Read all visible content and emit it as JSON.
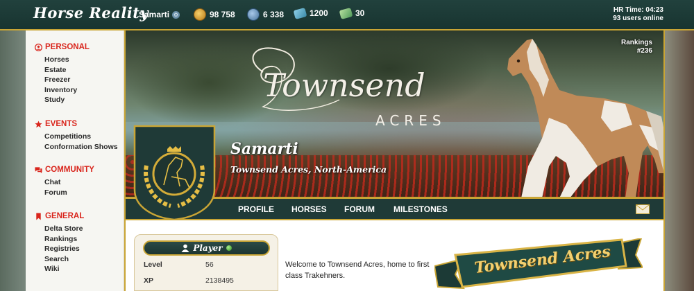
{
  "topbar": {
    "logo": "Horse Reality",
    "username": "Samarti",
    "currencies": [
      {
        "name": "coins",
        "icon": "coin-icon",
        "value": "98 758"
      },
      {
        "name": "passes",
        "icon": "pass-icon",
        "value": "6 338"
      },
      {
        "name": "tickets-blue",
        "icon": "ticket-icon",
        "value": "1200"
      },
      {
        "name": "tickets-green",
        "icon": "ticket-icon",
        "value": "30"
      }
    ],
    "time": "HR Time: 04:23",
    "online": "93 users online"
  },
  "sidebar": {
    "sections": [
      {
        "title": "PERSONAL",
        "icon": "user-icon",
        "items": [
          "Horses",
          "Estate",
          "Freezer",
          "Inventory",
          "Study"
        ]
      },
      {
        "title": "EVENTS",
        "icon": "star-icon",
        "items": [
          "Competitions",
          "Conformation Shows"
        ]
      },
      {
        "title": "COMMUNITY",
        "icon": "chat-icon",
        "items": [
          "Chat",
          "Forum"
        ]
      },
      {
        "title": "GENERAL",
        "icon": "bookmark-icon",
        "items": [
          "Delta Store",
          "Rankings",
          "Registries",
          "Search",
          "Wiki"
        ]
      }
    ]
  },
  "banner": {
    "title": "Townsend",
    "subtitle": "ACRES",
    "rankings_label": "Rankings",
    "rankings_value": "#236",
    "name": "Samarti",
    "location": "Townsend Acres, North-America"
  },
  "nav": [
    "PROFILE",
    "HORSES",
    "FORUM",
    "MILESTONES"
  ],
  "player": {
    "heading": "Player",
    "stats": [
      {
        "label": "Level",
        "value": "56"
      },
      {
        "label": "XP",
        "value": "2138495"
      }
    ]
  },
  "welcome": "Welcome to Townsend Acres, home to first class Trakehners.",
  "ribbon_text": "Townsend Acres",
  "colors": {
    "header_bg": "#1f3a37",
    "gold": "#c9a535",
    "accent_red": "#d9251c"
  }
}
